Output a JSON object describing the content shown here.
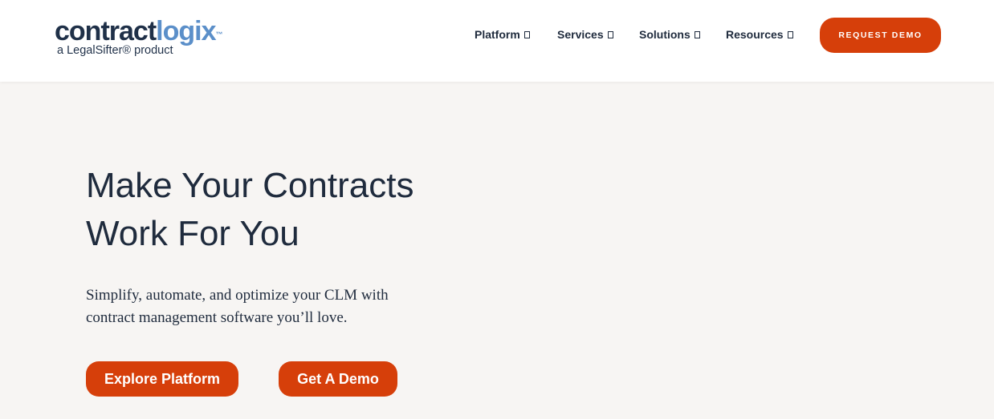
{
  "logo": {
    "part1": "contract",
    "part2": "logix",
    "tm": "™",
    "sub": "a LegalSifter® product"
  },
  "nav": {
    "items": [
      {
        "label": "Platform",
        "icon": "chevron-down-icon"
      },
      {
        "label": "Services",
        "icon": "chevron-down-icon"
      },
      {
        "label": "Solutions",
        "icon": "chevron-down-icon"
      },
      {
        "label": "Resources",
        "icon": "chevron-down-icon"
      }
    ],
    "cta_label": "REQUEST DEMO"
  },
  "hero": {
    "title_line1": "Make Your Contracts",
    "title_line2": "Work For You",
    "subtitle_line1": "Simplify, automate, and optimize your CLM with",
    "subtitle_line2": "contract management software you’ll love.",
    "primary_button": "Explore Platform",
    "secondary_button": "Get A Demo"
  },
  "colors": {
    "accent": "#d63f0a",
    "brand_dark": "#1f3048",
    "brand_light": "#5b8fc9",
    "background": "#f7f5f3"
  }
}
